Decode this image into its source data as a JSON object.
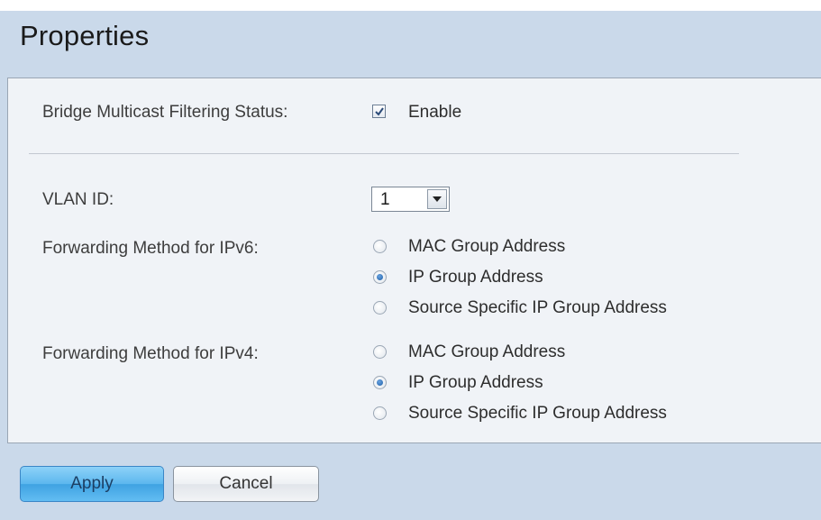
{
  "page": {
    "title": "Properties"
  },
  "form": {
    "bridge_label": "Bridge Multicast Filtering Status:",
    "bridge_checked": true,
    "bridge_value": "Enable",
    "vlan_label": "VLAN ID:",
    "vlan_value": "1",
    "ipv6": {
      "label": "Forwarding Method for IPv6:",
      "options": [
        "MAC Group Address",
        "IP Group Address",
        "Source Specific IP Group Address"
      ],
      "selected": "IP Group Address"
    },
    "ipv4": {
      "label": "Forwarding Method for IPv4:",
      "options": [
        "MAC Group Address",
        "IP Group Address",
        "Source Specific IP Group Address"
      ],
      "selected": "IP Group Address"
    }
  },
  "buttons": {
    "apply": "Apply",
    "cancel": "Cancel"
  },
  "colors": {
    "page_bg": "#cad9ea",
    "panel_bg": "#f0f3f7",
    "apply_button": "#5cb7ee",
    "radio_selected": "#1d5fa8"
  },
  "icons": {
    "checkbox": "check-icon",
    "select": "chevron-down-icon",
    "radio": "radio-icon"
  }
}
